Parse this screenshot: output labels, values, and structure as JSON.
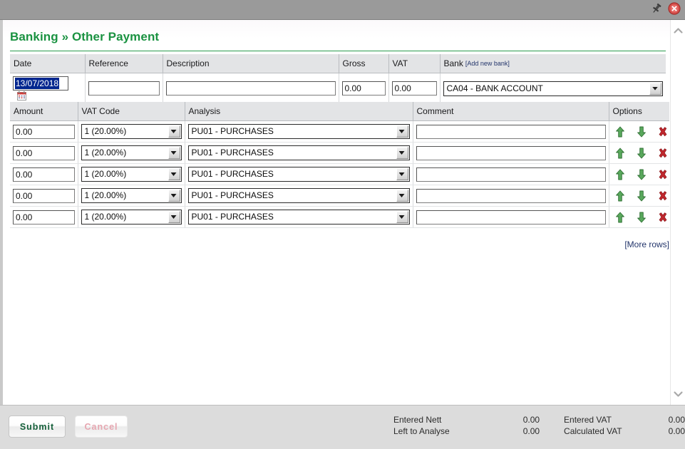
{
  "titlebar": {
    "pin_icon": "pushpin-icon",
    "close_icon": "close-icon"
  },
  "page": {
    "title": "Banking » Other Payment"
  },
  "header_form": {
    "columns": [
      "Date",
      "Reference",
      "Description",
      "Gross",
      "VAT",
      "Bank"
    ],
    "bank_add_link": "[Add new bank]",
    "date_value": "13/07/2018",
    "reference_value": "",
    "description_value": "",
    "gross_value": "0.00",
    "vat_value": "0.00",
    "bank_value": "CA04 - BANK ACCOUNT",
    "calendar_icon": "calendar-icon"
  },
  "lines": {
    "columns": [
      "Amount",
      "VAT Code",
      "Analysis",
      "Comment",
      "Options"
    ],
    "rows": [
      {
        "amount": "0.00",
        "vat_code": "1 (20.00%)",
        "analysis": "PU01 - PURCHASES",
        "comment": ""
      },
      {
        "amount": "0.00",
        "vat_code": "1 (20.00%)",
        "analysis": "PU01 - PURCHASES",
        "comment": ""
      },
      {
        "amount": "0.00",
        "vat_code": "1 (20.00%)",
        "analysis": "PU01 - PURCHASES",
        "comment": ""
      },
      {
        "amount": "0.00",
        "vat_code": "1 (20.00%)",
        "analysis": "PU01 - PURCHASES",
        "comment": ""
      },
      {
        "amount": "0.00",
        "vat_code": "1 (20.00%)",
        "analysis": "PU01 - PURCHASES",
        "comment": ""
      }
    ],
    "option_icons": [
      "move-up-icon",
      "move-down-icon",
      "delete-icon"
    ],
    "more_rows_label": "[More rows]"
  },
  "footer": {
    "submit_label": "Submit",
    "cancel_label": "Cancel",
    "totals": [
      {
        "label": "Entered Nett",
        "value": "0.00",
        "label2": "Entered VAT",
        "value2": "0.00"
      },
      {
        "label": "Left to Analyse",
        "value": "0.00",
        "label2": "Calculated VAT",
        "value2": "0.00"
      }
    ]
  },
  "colors": {
    "title_green": "#1a9241",
    "link_blue": "#23356b",
    "selection_blue": "#00268f",
    "titlebar_grey": "#9a9a9a",
    "header_grey": "#e3e4e6",
    "footer_grey": "#dcdcdc",
    "arrow_green": "#3f9a43",
    "delete_red": "#c0272d",
    "submit_green": "#15603a",
    "cancel_pink": "#e6a6b0"
  }
}
